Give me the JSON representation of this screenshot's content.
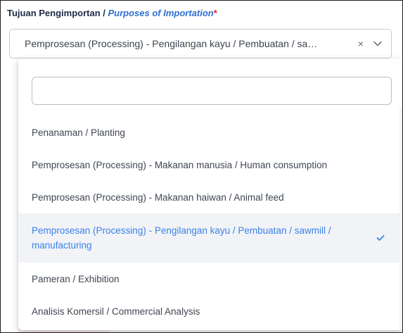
{
  "field": {
    "label_ms": "Tujuan Pengimportan / ",
    "label_en": "Purposes of Importation",
    "required_mark": "*",
    "selected_value": "Pemprosesan (Processing) - Pengilangan kayu / Pembuatan / sa…",
    "clear_icon": "×",
    "chevron_icon": "chevron-down-icon"
  },
  "dropdown": {
    "search_value": "",
    "search_placeholder": "",
    "options": [
      {
        "label": "Penanaman / Planting",
        "selected": false
      },
      {
        "label": "Pemprosesan (Processing) - Makanan manusia / Human consumption",
        "selected": false
      },
      {
        "label": "Pemprosesan (Processing) - Makanan haiwan / Animal feed",
        "selected": false
      },
      {
        "label": "Pemprosesan (Processing) - Pengilangan kayu / Pembuatan / sawmill / manufacturing",
        "selected": true
      },
      {
        "label": "Pameran / Exhibition",
        "selected": false
      },
      {
        "label": "Analisis Komersil / Commercial Analysis",
        "selected": false
      }
    ]
  },
  "colors": {
    "accent": "#3b82e8",
    "label_dark": "#1e2a44",
    "label_en": "#2f6fd1",
    "required": "#d8233b",
    "selected_bg": "#f1f3f6"
  }
}
